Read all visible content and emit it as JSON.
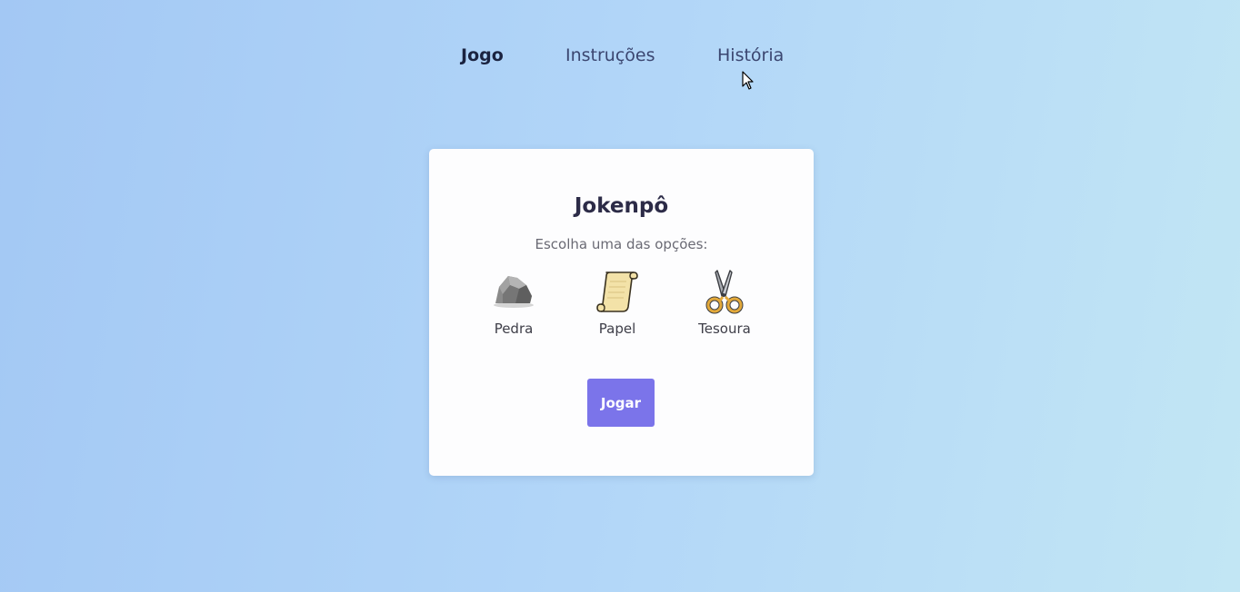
{
  "nav": {
    "items": [
      {
        "label": "Jogo",
        "active": true
      },
      {
        "label": "Instruções",
        "active": false
      },
      {
        "label": "História",
        "active": false
      }
    ]
  },
  "game": {
    "title": "Jokenpô",
    "subtitle": "Escolha uma das opções:",
    "options": [
      {
        "label": "Pedra",
        "icon": "rock-icon"
      },
      {
        "label": "Papel",
        "icon": "paper-scroll-icon"
      },
      {
        "label": "Tesoura",
        "icon": "scissors-icon"
      }
    ],
    "play_label": "Jogar"
  },
  "colors": {
    "accent": "#7b74ea",
    "card_background": "#fdfdfe",
    "background_start": "#a3c8f4",
    "background_end": "#c2e6f4"
  }
}
